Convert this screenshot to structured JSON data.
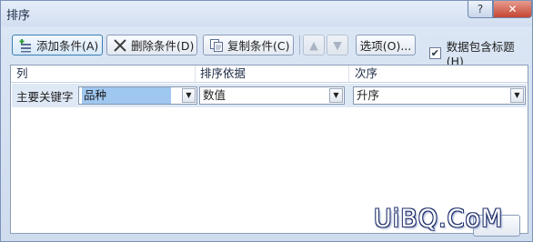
{
  "window": {
    "title": "排序",
    "help_label": "?",
    "close_label": "✕"
  },
  "toolbar": {
    "add_label": "添加条件(A)",
    "delete_label": "删除条件(D)",
    "copy_label": "复制条件(C)",
    "move_up_label": "▲",
    "move_down_label": "▼",
    "options_label": "选项(O)...",
    "header_checkbox_label": "数据包含标题(H)",
    "header_checkbox_checked": true,
    "checkbox_mark": "✔"
  },
  "grid": {
    "headers": {
      "column": "列",
      "sort_on": "排序依据",
      "order": "次序"
    },
    "rows": [
      {
        "label": "主要关键字",
        "key_value": "品种",
        "sort_on_value": "数值",
        "order_value": "升序"
      }
    ]
  },
  "watermark": {
    "text": "UiBQ.CoM"
  },
  "colors": {
    "selection": "#9fc7f0",
    "row_highlight": "#dfe9f6",
    "close_button": "#c54632"
  }
}
